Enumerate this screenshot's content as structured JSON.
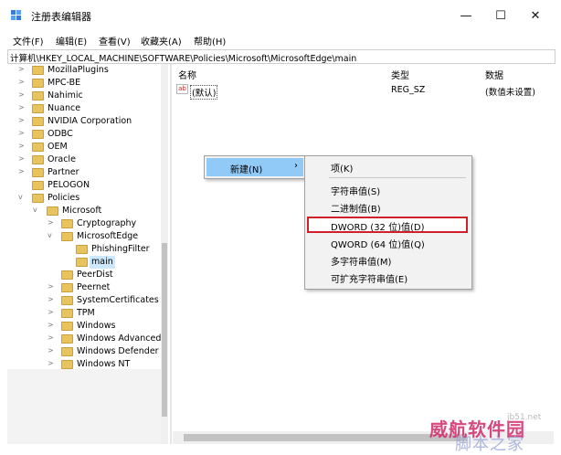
{
  "window": {
    "title": "注册表编辑器",
    "controls": {
      "minimize": "—",
      "maximize": "☐",
      "close": "✕"
    }
  },
  "menubar": [
    "文件(F)",
    "编辑(E)",
    "查看(V)",
    "收藏夹(A)",
    "帮助(H)"
  ],
  "address": "计算机\\HKEY_LOCAL_MACHINE\\SOFTWARE\\Policies\\Microsoft\\MicrosoftEdge\\main",
  "tree": {
    "items": [
      {
        "label": "MozillaPlugins",
        "expander": ">"
      },
      {
        "label": "MPC-BE",
        "expander": ">"
      },
      {
        "label": "Nahimic",
        "expander": ">"
      },
      {
        "label": "Nuance",
        "expander": ">"
      },
      {
        "label": "NVIDIA Corporation",
        "expander": ">"
      },
      {
        "label": "ODBC",
        "expander": ">"
      },
      {
        "label": "OEM",
        "expander": ">"
      },
      {
        "label": "Oracle",
        "expander": ">"
      },
      {
        "label": "Partner",
        "expander": ">"
      },
      {
        "label": "PELOGON",
        "expander": ""
      },
      {
        "label": "Policies",
        "expander": "v"
      },
      {
        "label": "Microsoft",
        "expander": "v"
      },
      {
        "label": "Cryptography",
        "expander": ">"
      },
      {
        "label": "MicrosoftEdge",
        "expander": "v"
      },
      {
        "label": "PhishingFilter",
        "expander": ""
      },
      {
        "label": "main",
        "expander": ""
      },
      {
        "label": "PeerDist",
        "expander": ""
      },
      {
        "label": "Peernet",
        "expander": ">"
      },
      {
        "label": "SystemCertificates",
        "expander": ">"
      },
      {
        "label": "TPM",
        "expander": ">"
      },
      {
        "label": "Windows",
        "expander": ">"
      },
      {
        "label": "Windows Advanced",
        "expander": ">"
      },
      {
        "label": "Windows Defender",
        "expander": ">"
      },
      {
        "label": "Windows NT",
        "expander": ">"
      }
    ]
  },
  "values_pane": {
    "columns": {
      "name": "名称",
      "type": "类型",
      "data": "数据"
    },
    "rows": [
      {
        "icon": "ab",
        "name": "(默认)",
        "type": "REG_SZ",
        "data": "(数值未设置)"
      }
    ]
  },
  "context_menu": {
    "new_label": "新建(N)",
    "arrow": "›"
  },
  "submenu": {
    "items": [
      "项(K)",
      "字符串值(S)",
      "二进制值(B)",
      "DWORD (32 位)值(D)",
      "QWORD (64 位)值(Q)",
      "多字符串值(M)",
      "可扩充字符串值(E)"
    ]
  },
  "watermark": {
    "brand": "威航软件园",
    "subtitle": "脚本之家",
    "url": "jb51.net"
  },
  "colors": {
    "highlight_border": "#d0202a",
    "menu_hover": "#91c9f7",
    "folder": "#e8c35e",
    "selected_tree": "#cce8ff"
  }
}
